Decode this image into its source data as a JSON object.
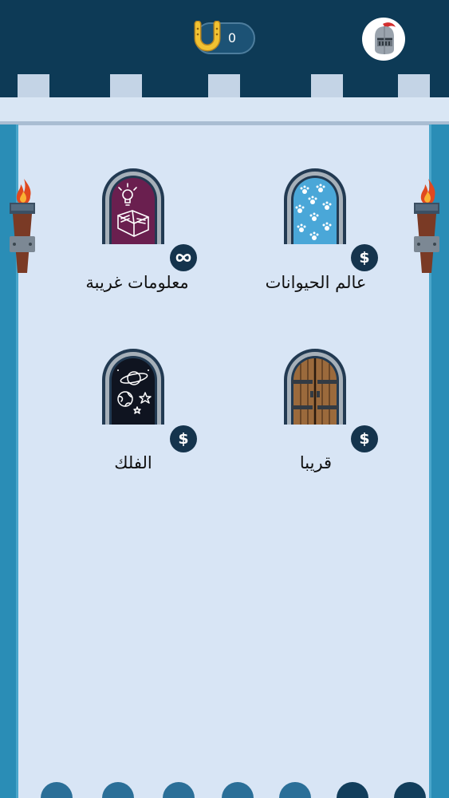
{
  "header": {
    "coins": "0",
    "coin_icon": "horseshoe-icon",
    "avatar_icon": "knight-helmet-icon",
    "colors": {
      "bar": "#0d3a56",
      "wall": "#2a8db6",
      "floor": "#d8e5f5"
    }
  },
  "categories": [
    {
      "label": "عالم الحيوانات",
      "icon": "paw-prints-icon",
      "door_fill": "#4aa7d8",
      "badge": "$"
    },
    {
      "label": "معلومات غريبة",
      "icon": "lightbulb-book-icon",
      "door_fill": "#6a1f4f",
      "badge_icon": "infinity-icon"
    },
    {
      "label": "قريبا",
      "icon": "wooden-door-icon",
      "door_fill": "#9b6a3c",
      "badge": "$"
    },
    {
      "label": "الفلك",
      "icon": "planet-stars-icon",
      "door_fill": "#0f1420",
      "badge": "$"
    }
  ]
}
